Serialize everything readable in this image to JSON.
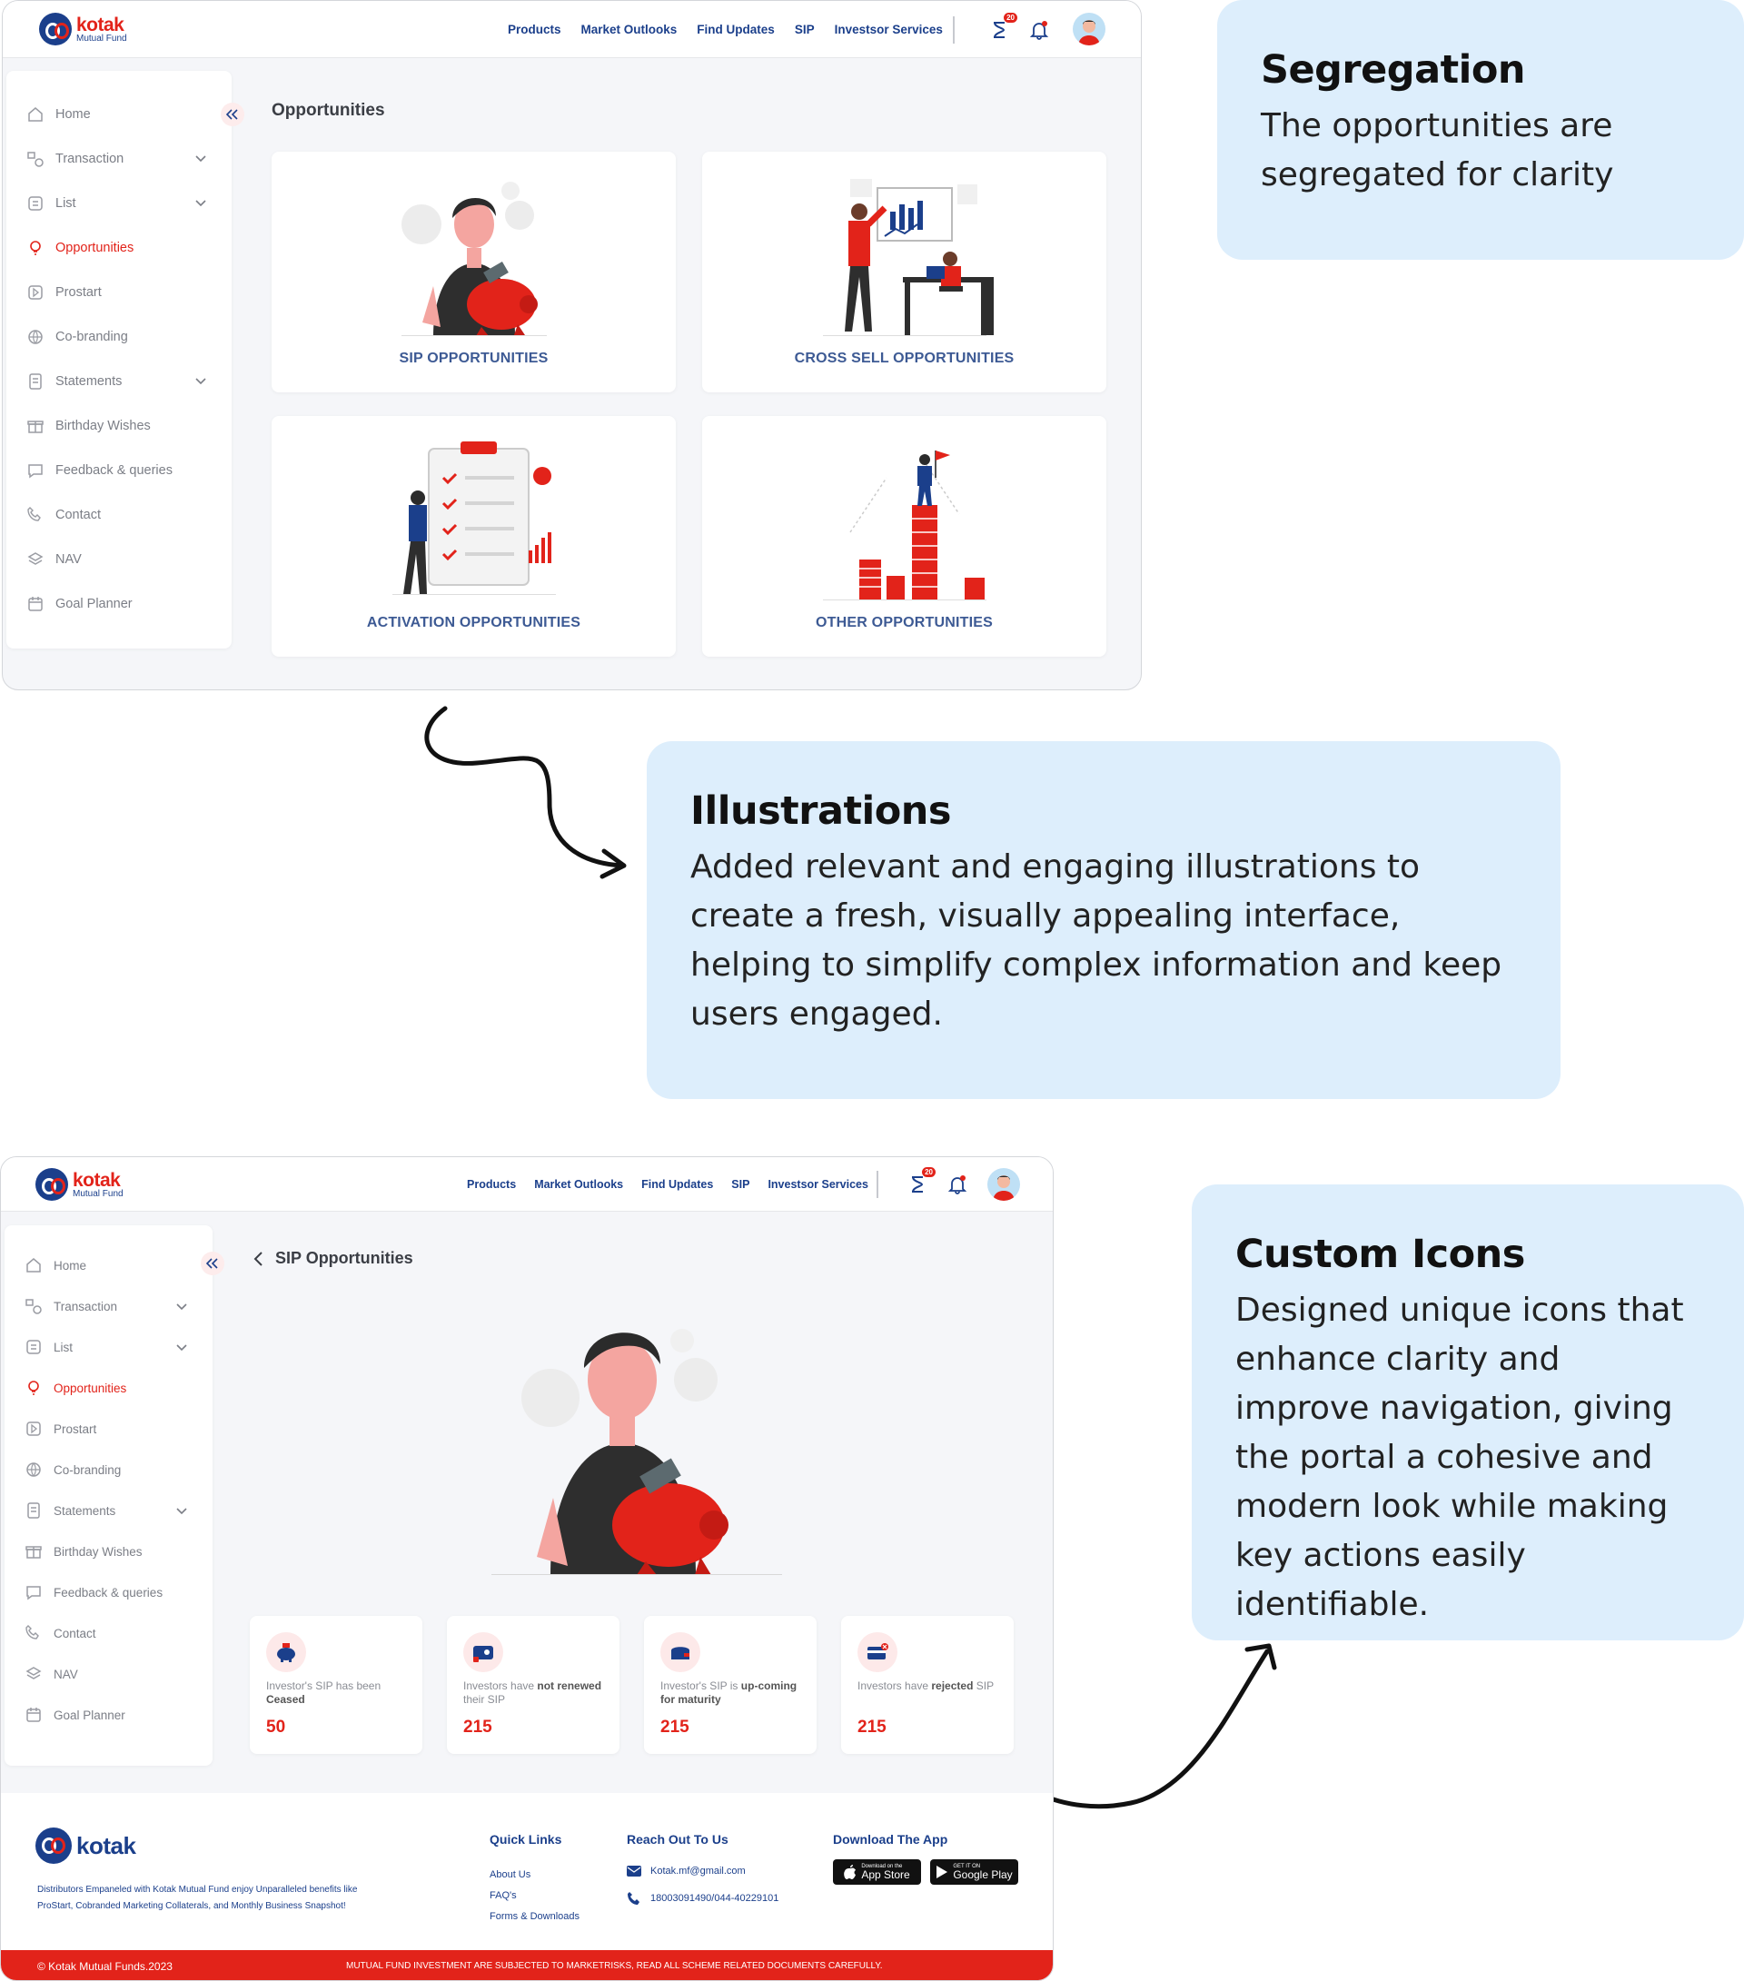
{
  "brand": {
    "name": "kotak",
    "sub": "Mutual Fund"
  },
  "nav": [
    "Products",
    "Market Outlooks",
    "Find Updates",
    "SIP",
    "Investsor Services"
  ],
  "header": {
    "cart_badge": "20"
  },
  "sidebar": {
    "items": [
      {
        "label": "Home",
        "icon": "home-icon"
      },
      {
        "label": "Transaction",
        "icon": "transaction-icon",
        "expandable": true
      },
      {
        "label": "List",
        "icon": "list-icon",
        "expandable": true
      },
      {
        "label": "Opportunities",
        "icon": "lightbulb-icon",
        "active": true
      },
      {
        "label": "Prostart",
        "icon": "prostart-icon"
      },
      {
        "label": "Co-branding",
        "icon": "globe-icon"
      },
      {
        "label": "Statements",
        "icon": "statement-icon",
        "expandable": true
      },
      {
        "label": "Birthday Wishes",
        "icon": "gift-icon"
      },
      {
        "label": "Feedback & queries",
        "icon": "feedback-icon"
      },
      {
        "label": "Contact",
        "icon": "phone-icon"
      },
      {
        "label": "NAV",
        "icon": "layers-icon"
      },
      {
        "label": "Goal Planner",
        "icon": "calendar-icon"
      }
    ]
  },
  "opportunities_page": {
    "title": "Opportunities",
    "cards": [
      "SIP OPPORTUNITIES",
      "CROSS SELL OPPORTUNITIES",
      "ACTIVATION OPPORTUNITIES",
      "OTHER OPPORTUNITIES"
    ]
  },
  "sip_page": {
    "title": "SIP Opportunities",
    "stats": [
      {
        "pre": "Investor's SIP has been ",
        "bold": "Ceased",
        "post": "",
        "value": "50"
      },
      {
        "pre": "Investors have ",
        "bold": "not renewed",
        "post": " their SIP",
        "value": "215"
      },
      {
        "pre": "Investor's SIP is ",
        "bold": "up-coming for maturity",
        "post": "",
        "value": "215"
      },
      {
        "pre": "Investors have ",
        "bold": "rejected",
        "post": " SIP",
        "value": "215"
      }
    ]
  },
  "footer": {
    "brand": "kotak",
    "desc_line1": "Distributors Empaneled with Kotak Mutual Fund enjoy Unparalleled benefits like",
    "desc_line2": "ProStart, Cobranded Marketing Collaterals, and Monthly Business Snapshot!",
    "quick_links_title": "Quick Links",
    "quick_links": [
      "About Us",
      "FAQ's",
      "Forms & Downloads"
    ],
    "reach_title": "Reach Out To Us",
    "email": "Kotak.mf@gmail.com",
    "phone": "18003091490/044-40229101",
    "app_title": "Download The App",
    "app_store": "App Store",
    "google_play": "Google Play",
    "app_store_small": "Download on the",
    "google_play_small": "GET IT ON",
    "copyright": "© Kotak Mutual Funds.2023",
    "disclaimer": "MUTUAL FUND INVESTMENT ARE SUBJECTED TO MARKETRISKS, READ ALL SCHEME RELATED DOCUMENTS CAREFULLY."
  },
  "notes": {
    "segregation": {
      "title": "Segregation",
      "body": "The opportunities are segregated for clarity"
    },
    "illustrations": {
      "title": "Illustrations",
      "body": "Added relevant and engaging illustrations to create a fresh, visually appealing interface, helping to simplify complex information and keep users engaged."
    },
    "custom_icons": {
      "title": "Custom Icons",
      "body": "Designed unique icons that enhance clarity and improve navigation, giving the portal a cohesive and modern look while making key actions easily identifiable."
    }
  },
  "colors": {
    "brand_red": "#e2231a",
    "brand_blue": "#1b3f8b",
    "note_bg": "#ddeefc"
  }
}
